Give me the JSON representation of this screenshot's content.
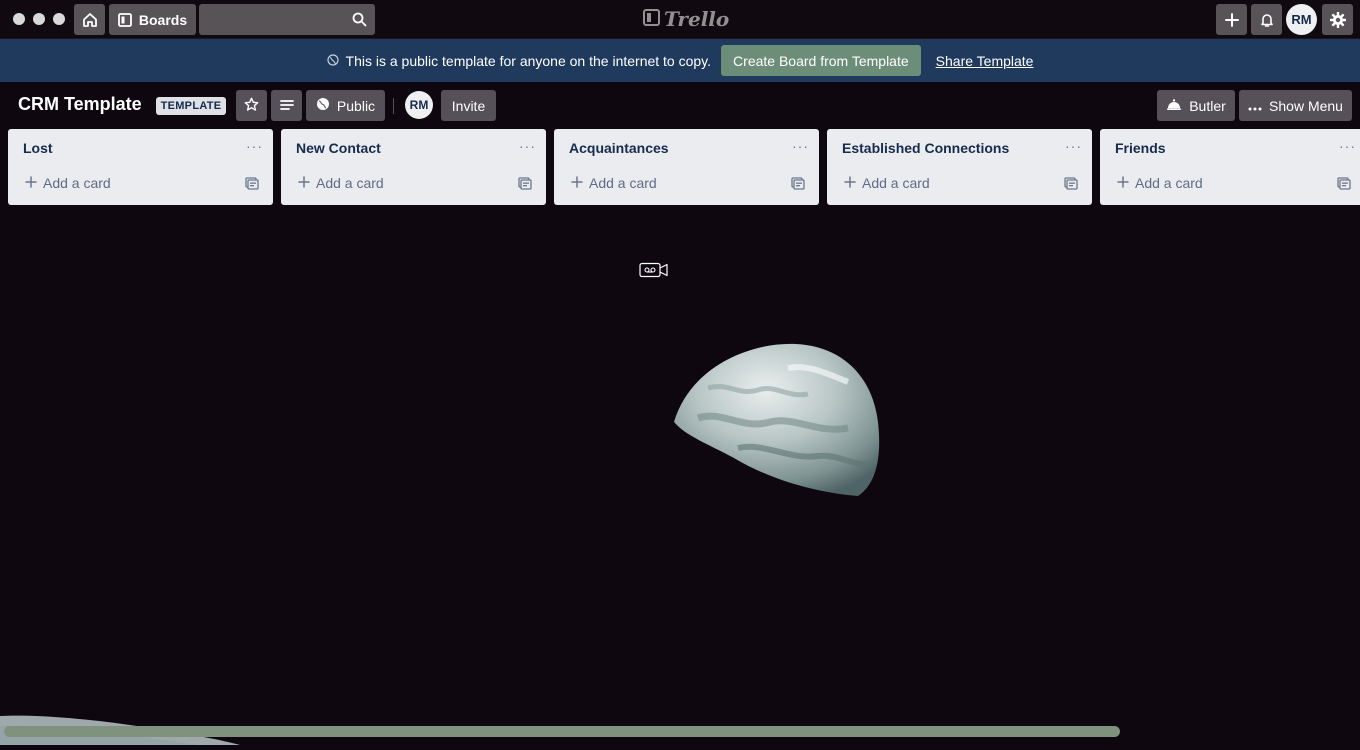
{
  "app": {
    "name": "Trello"
  },
  "topbar": {
    "boards_label": "Boards",
    "search_value": "",
    "avatar_initials": "RM"
  },
  "banner": {
    "message": "This is a public template for anyone on the internet to copy.",
    "create_label": "Create Board from Template",
    "share_label": "Share Template"
  },
  "board": {
    "title": "CRM Template",
    "badge": "TEMPLATE",
    "visibility_label": "Public",
    "member_initials": "RM",
    "invite_label": "Invite",
    "butler_label": "Butler",
    "show_menu_label": "Show Menu"
  },
  "lists": [
    {
      "title": "Lost",
      "add_card_label": "Add a card"
    },
    {
      "title": "New Contact",
      "add_card_label": "Add a card"
    },
    {
      "title": "Acquaintances",
      "add_card_label": "Add a card"
    },
    {
      "title": "Established Connections",
      "add_card_label": "Add a card"
    },
    {
      "title": "Friends",
      "add_card_label": "Add a card"
    }
  ],
  "list_menu_glyph": "···",
  "colors": {
    "board_background": "#0e0710",
    "banner": "#1f3a5c",
    "create_button": "#6c8e78",
    "list_background": "#ebecf0",
    "scrollbar_thumb": "#7e927e"
  }
}
